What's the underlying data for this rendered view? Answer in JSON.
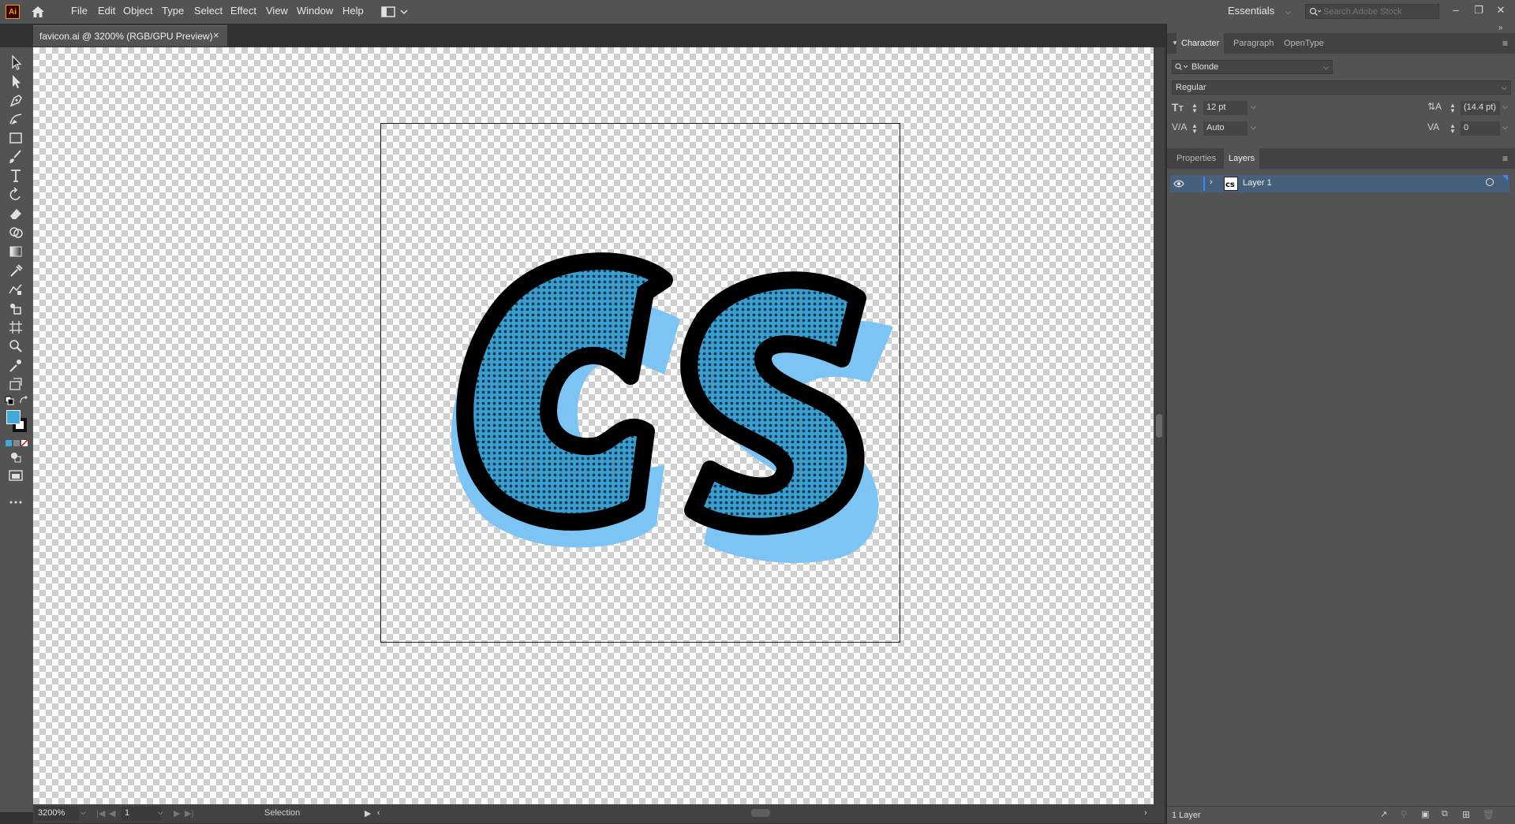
{
  "app": {
    "logo": "Ai",
    "menus": [
      "File",
      "Edit",
      "Object",
      "Type",
      "Select",
      "Effect",
      "View",
      "Window",
      "Help"
    ],
    "workspace": "Essentials",
    "search_placeholder": "Search Adobe Stock"
  },
  "document": {
    "tab_title": "favicon.ai @ 3200% (RGB/GPU Preview)",
    "close_glyph": "×"
  },
  "status": {
    "zoom": "3200%",
    "artboard_number": "1",
    "tool_name": "Selection"
  },
  "character_panel": {
    "tabs": [
      "Character",
      "Paragraph",
      "OpenType"
    ],
    "font_family": "Blonde",
    "font_style": "Regular",
    "font_size": "12 pt",
    "leading": "(14.4 pt)",
    "kerning": "Auto",
    "tracking": "0"
  },
  "layers_panel": {
    "tabs": [
      "Properties",
      "Layers"
    ],
    "layers": [
      {
        "name": "Layer 1"
      }
    ],
    "footer_count": "1 Layer"
  },
  "colors": {
    "fill": "#3fa9dc",
    "stroke": "#000000",
    "accent": "#2f79c6",
    "layer_color": "#4a7ef5"
  },
  "artwork": {
    "text": "CS",
    "letter_fill": "#3a9fd0",
    "shadow_fill": "#7cc4f3",
    "outline": "#000000"
  }
}
